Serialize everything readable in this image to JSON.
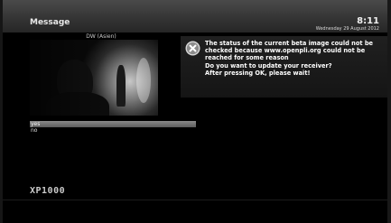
{
  "header": {
    "title": "Message",
    "time": "8:11",
    "date": "Wednesday 29 August 2012"
  },
  "pip": {
    "channel_label": "DW (Asien)"
  },
  "message": {
    "icon": "info-icon",
    "lines": [
      "The status of the current beta image could not be",
      "checked because www.openpli.org could not be",
      "reached for some reason",
      "Do you want to update your receiver?",
      "After pressing OK, please wait!"
    ]
  },
  "choices": [
    {
      "label": "yes",
      "selected": true
    },
    {
      "label": "no",
      "selected": false
    }
  ],
  "footer": {
    "model": "XP1000"
  }
}
